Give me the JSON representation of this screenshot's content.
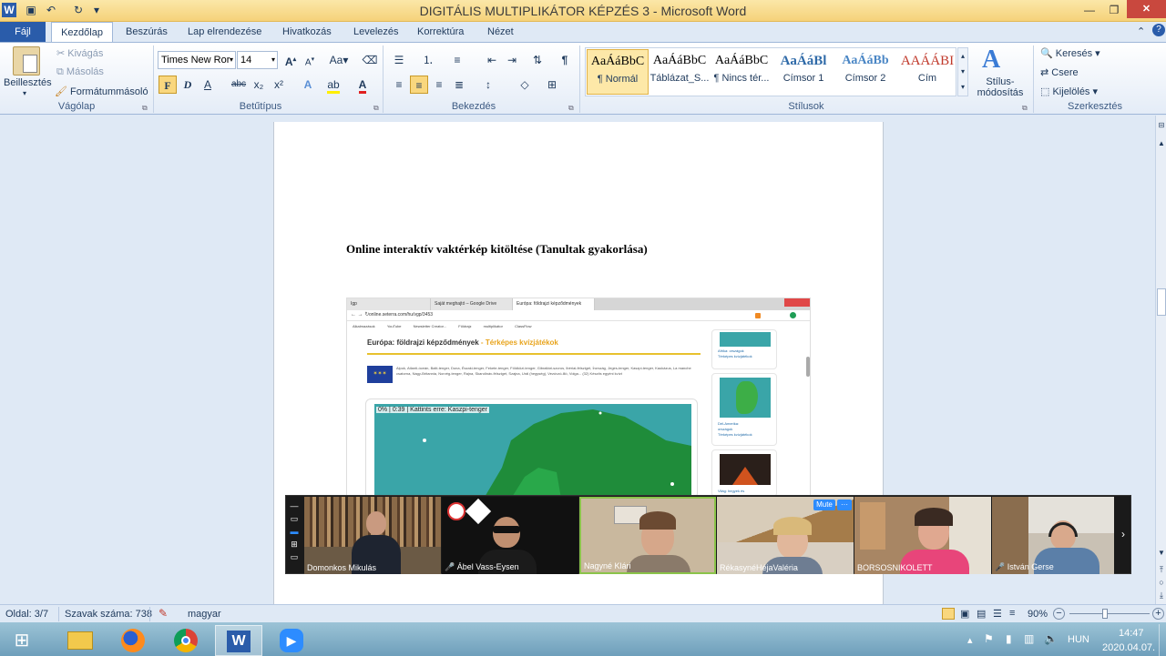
{
  "window": {
    "title": "DIGITÁLIS MULTIPLIKÁTOR KÉPZÉS 3  -  Microsoft Word"
  },
  "tabs": [
    "Fájl",
    "Kezdőlap",
    "Beszúrás",
    "Lap elrendezése",
    "Hivatkozás",
    "Levelezés",
    "Korrektúra",
    "Nézet"
  ],
  "ribbon": {
    "clipboard": {
      "paste": "Beillesztés",
      "cut": "Kivágás",
      "copy": "Másolás",
      "format_painter": "Formátummásoló",
      "label": "Vágólap"
    },
    "font": {
      "name": "Times New Ror",
      "size": "14",
      "bold": "F",
      "italic": "D",
      "underline": "A",
      "strike": "abc",
      "sub": "x₂",
      "sup": "x²",
      "label": "Betűtípus"
    },
    "paragraph": {
      "label": "Bekezdés"
    },
    "styles": {
      "items": [
        {
          "sample": "AaÁáBbC",
          "name": "¶ Normál",
          "color": "#000000"
        },
        {
          "sample": "AaÁáBbC",
          "name": "Táblázat_S...",
          "color": "#000000"
        },
        {
          "sample": "AaÁáBbC",
          "name": "¶ Nincs tér...",
          "color": "#000000"
        },
        {
          "sample": "AaÁáBl",
          "name": "Címsor 1",
          "color": "#2f6aa8"
        },
        {
          "sample": "AaÁáBb",
          "name": "Címsor 2",
          "color": "#4a86c5"
        },
        {
          "sample": "AAÁÁBI",
          "name": "Cím",
          "color": "#c0392b"
        }
      ],
      "change": "Stílus-\nmódosítás",
      "label": "Stílusok"
    },
    "editing": {
      "find": "Keresés",
      "replace": "Csere",
      "select": "Kijelölés",
      "label": "Szerkesztés"
    }
  },
  "document": {
    "heading": "Online interaktív vaktérkép kitöltése (Tanultak gyakorlása)",
    "embedded": {
      "tab1": "Igp",
      "tab2": "Saját meghajtó – Google Drive",
      "tab3": "Európa: földrajzi képződmények",
      "url": "online.seterra.com/hu/vgp/3453",
      "bookmarks": [
        "Alkalmazások",
        "YouTube",
        "Newsletter Creator...",
        "Földrajz",
        "multiplikátor",
        "ClassFlow"
      ],
      "title_a": "Európa: földrajzi képződmények",
      "title_b": " - Térképes kvízjátékok",
      "desc": "Alpok, Atlanti-óceán, Balti-tenger, Duna, Északi-tenger, Fekete-tenger, Földközi-tenger, Gibraltári-szoros, Ibériai-félsziget, Írország, Jeges-tenger, Kaszpi-tenger, Kaukázus, La manche csatorna, Nagy-Britannia, Norvég-tenger, Rajna, Skandináv-félsziget, Szajna, Urál (hegység), Vezúvzó-illó, Volga... (32)  Készíts egyéni kvízt",
      "quiz_status": "0% | 0:39 | Kattints erre: Kaszpi-tenger",
      "side1": "Afrika: országok\nTérképes kvízjátékok",
      "side2": "Dél-Amerika:\nországok\nTérképes kvízjátékok",
      "side3": "Világ: hegyek és"
    }
  },
  "zoom": {
    "mute": "Mute",
    "more": "···",
    "participants": [
      "Domonkos Mikulás",
      "Ábel Vass-Eysen",
      "Nagyné Klári",
      "RékasynéHéjaValéria",
      "BORSOSNIKOLETT",
      "István Gerse"
    ]
  },
  "status": {
    "page": "Oldal: 3/7",
    "words": "Szavak száma: 738",
    "lang": "magyar",
    "zoom": "90%"
  },
  "taskbar": {
    "lang": "HUN",
    "time": "14:47",
    "date": "2020.04.07."
  }
}
